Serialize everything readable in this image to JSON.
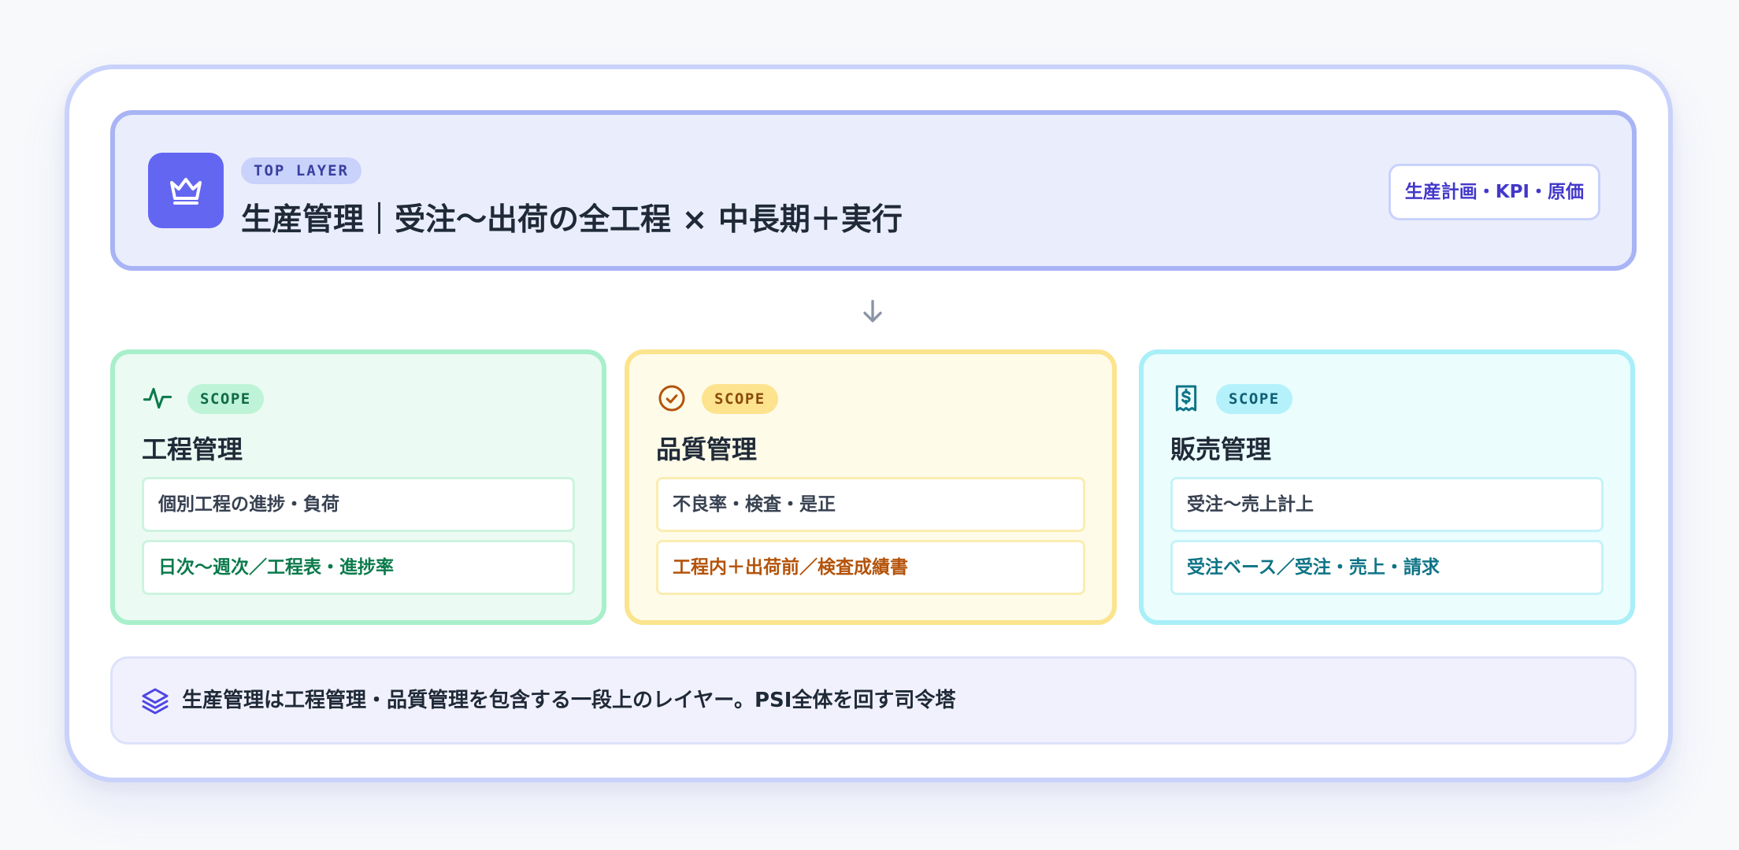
{
  "top_layer": {
    "badge": "TOP LAYER",
    "title": "生産管理｜受注〜出荷の全工程 × 中長期＋実行",
    "tag": "生産計画・KPI・原価",
    "icon": "crown-icon",
    "accent": "#6366f1"
  },
  "scopes": [
    {
      "badge": "SCOPE",
      "title": "工程管理",
      "icon": "activity-icon",
      "rows": [
        "個別工程の進捗・負荷",
        "日次〜週次／工程表・進捗率"
      ],
      "color": "#0b7a4b"
    },
    {
      "badge": "SCOPE",
      "title": "品質管理",
      "icon": "check-circle-icon",
      "rows": [
        "不良率・検査・是正",
        "工程内＋出荷前／検査成績書"
      ],
      "color": "#b4530a"
    },
    {
      "badge": "SCOPE",
      "title": "販売管理",
      "icon": "receipt-dollar-icon",
      "rows": [
        "受注〜売上計上",
        "受注ベース／受注・売上・請求"
      ],
      "color": "#0e7486"
    }
  ],
  "note": {
    "icon": "layers-icon",
    "text": "生産管理は工程管理・品質管理を包含する一段上のレイヤー。PSI全体を回す司令塔"
  }
}
